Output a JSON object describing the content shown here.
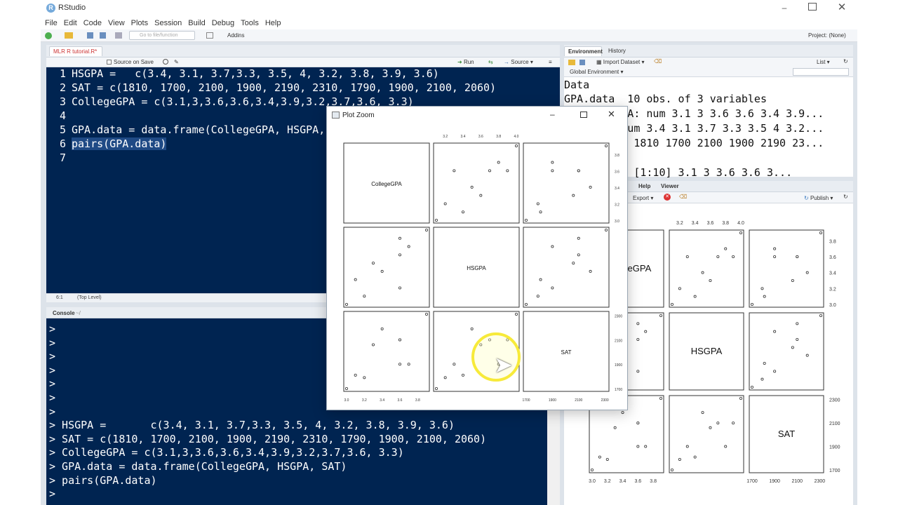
{
  "app": {
    "title": "RStudio"
  },
  "menu": [
    "File",
    "Edit",
    "Code",
    "View",
    "Plots",
    "Session",
    "Build",
    "Debug",
    "Tools",
    "Help"
  ],
  "toolbar": {
    "goto_placeholder": "Go to file/function",
    "addins": "Addins",
    "project": "Project: (None)"
  },
  "editor": {
    "tab": "MLR R tutorial.R*",
    "source_on_save": "Source on Save",
    "run": "Run",
    "source": "Source",
    "lines": [
      "HSGPA =   c(3.4, 3.1, 3.7,3.3, 3.5, 4, 3.2, 3.8, 3.9, 3.6)",
      "SAT = c(1810, 1700, 2100, 1900, 2190, 2310, 1790, 1900, 2100, 2060)",
      "CollegeGPA = c(3.1,3,3.6,3.6,3.4,3.9,3.2,3.7,3.6, 3.3)",
      "",
      "GPA.data = data.frame(CollegeGPA, HSGPA, SAT)",
      "pairs(GPA.data)",
      ""
    ],
    "status_pos": "6:1",
    "status_level": "(Top Level)"
  },
  "console": {
    "tab": "Console",
    "path": "~/",
    "lines": [
      ">",
      ">",
      ">",
      ">",
      ">",
      ">",
      ">",
      "> HSGPA =       c(3.4, 3.1, 3.7,3.3, 3.5, 4, 3.2, 3.8, 3.9, 3.6)",
      "> SAT = c(1810, 1700, 2100, 1900, 2190, 2310, 1790, 1900, 2100, 2060)",
      "> CollegeGPA = c(3.1,3,3.6,3.6,3.4,3.9,3.2,3.7,3.6, 3.3)",
      "> GPA.data = data.frame(CollegeGPA, HSGPA, SAT)",
      "> pairs(GPA.data)",
      ">"
    ]
  },
  "environment": {
    "tabs": [
      "Environment",
      "History"
    ],
    "import": "Import Dataset",
    "list": "List",
    "global": "Global Environment",
    "section": "Data",
    "rows": [
      "GPA.data  10 obs. of 3 variables",
      "   llegeGPA: num 3.1 3 3.6 3.6 3.4 3.9...",
      "   SGPA: num 3.4 3.1 3.7 3.3 3.5 4 3.2...",
      "   AT: num 1810 1700 2100 1900 2190 23...",
      "",
      "   GPA num [1:10] 3.1 3 3.6 3.6 3..."
    ]
  },
  "plots": {
    "tabs": [
      "Files",
      "Plots",
      "Packages",
      "Help",
      "Viewer"
    ],
    "export": "Export",
    "publish": "Publish"
  },
  "zoom": {
    "title": "Plot Zoom"
  },
  "chart_data": {
    "type": "scatter",
    "title": "pairs(GPA.data)",
    "variables": [
      "CollegeGPA",
      "HSGPA",
      "SAT"
    ],
    "CollegeGPA": [
      3.1,
      3,
      3.6,
      3.6,
      3.4,
      3.9,
      3.2,
      3.7,
      3.6,
      3.3
    ],
    "HSGPA": [
      3.4,
      3.1,
      3.7,
      3.3,
      3.5,
      4,
      3.2,
      3.8,
      3.9,
      3.6
    ],
    "SAT": [
      1810,
      1700,
      2100,
      1900,
      2190,
      2310,
      1790,
      1900,
      2100,
      2060
    ],
    "ranges": {
      "CollegeGPA": [
        3.0,
        3.9
      ],
      "HSGPA": [
        3.1,
        4.0
      ],
      "SAT": [
        1700,
        2310
      ]
    },
    "ticks_hsgpa": [
      "3.2",
      "3.4",
      "3.6",
      "3.8",
      "4.0"
    ],
    "ticks_college": [
      "3.0",
      "3.2",
      "3.4",
      "3.6",
      "3.8"
    ],
    "ticks_sat": [
      "1700",
      "1900",
      "2100",
      "2300"
    ],
    "ticks_sat_zoom": [
      "1700",
      "1800",
      "1900",
      "2000",
      "2100",
      "2200",
      "2300"
    ]
  }
}
